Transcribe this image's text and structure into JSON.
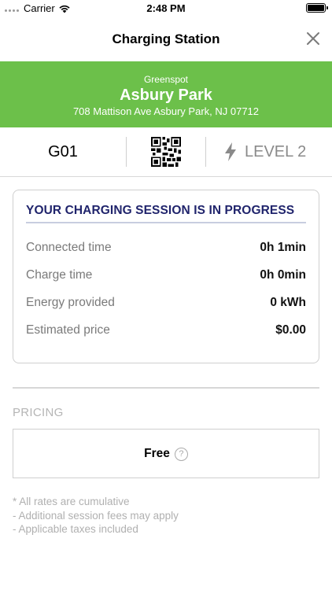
{
  "status_bar": {
    "carrier": "Carrier",
    "time": "2:48 PM",
    "icons": [
      "signal-dots-icon",
      "wifi-icon",
      "battery-icon"
    ]
  },
  "nav": {
    "title": "Charging Station",
    "close_icon": "close-icon"
  },
  "station": {
    "network": "Greenspot",
    "name": "Asbury Park",
    "address": "708 Mattison Ave Asbury Park, NJ 07712",
    "header_color": "#6cc04a"
  },
  "port": {
    "id": "G01",
    "qr_icon": "qr-code-icon",
    "level_icon": "lightning-bolt-icon",
    "level": "LEVEL 2"
  },
  "session": {
    "title": "YOUR CHARGING SESSION IS IN PROGRESS",
    "title_color": "#20246c",
    "rows": [
      {
        "label": "Connected time",
        "value": "0h 1min"
      },
      {
        "label": "Charge time",
        "value": "0h 0min"
      },
      {
        "label": "Energy provided",
        "value": "0 kWh"
      },
      {
        "label": "Estimated price",
        "value": "$0.00"
      }
    ]
  },
  "pricing": {
    "label": "PRICING",
    "value": "Free",
    "help_icon": "help-circle-icon",
    "help_glyph": "?"
  },
  "notes": [
    "* All rates are cumulative",
    "- Additional session fees may apply",
    "- Applicable taxes included"
  ]
}
